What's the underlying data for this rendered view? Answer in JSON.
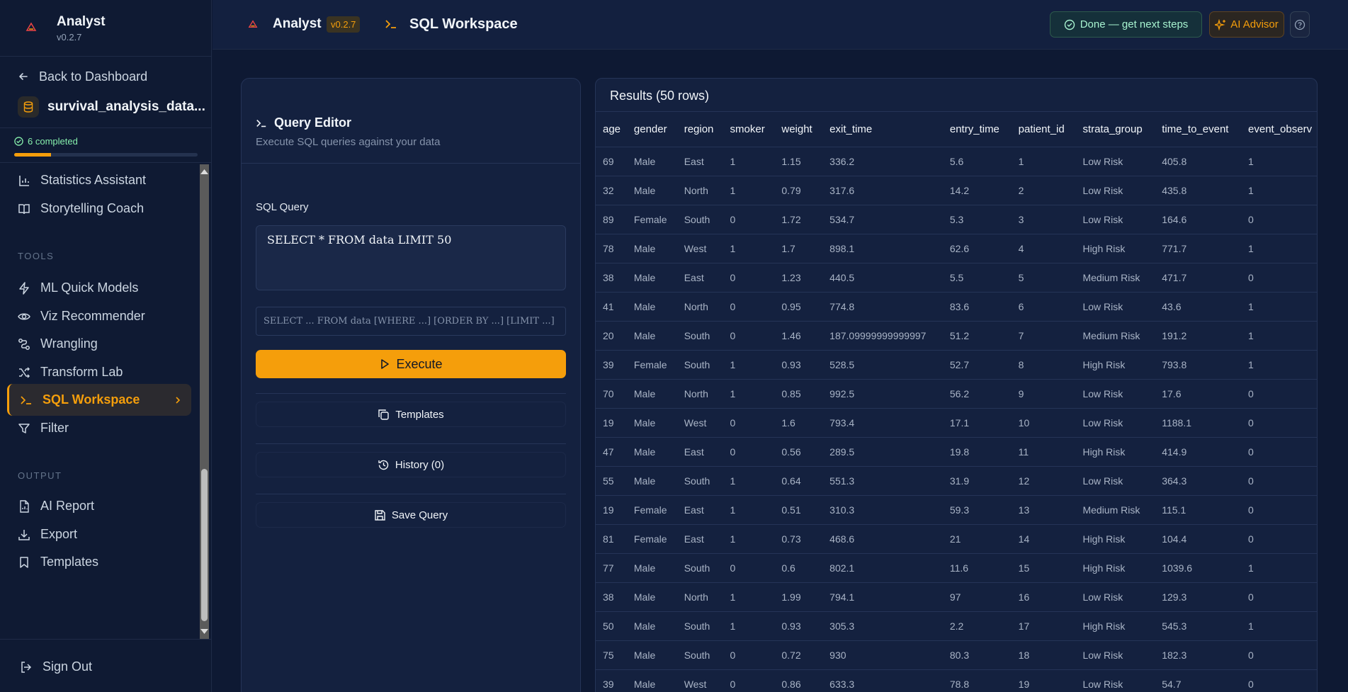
{
  "app": {
    "name": "Analyst",
    "version": "v0.2.7",
    "version_badge": "v0.2.7",
    "page_title": "SQL Workspace"
  },
  "sidebar": {
    "back_label": "Back to Dashboard",
    "dataset_name": "survival_analysis_data...",
    "progress": {
      "label": "6 completed",
      "fraction": 0.2
    },
    "items": [
      {
        "label": "Statistics Assistant",
        "icon": "bar-chart-icon"
      },
      {
        "label": "Storytelling Coach",
        "icon": "book-icon"
      }
    ],
    "tools_heading": "TOOLS",
    "tools": [
      {
        "label": "ML Quick Models",
        "icon": "lightning-icon"
      },
      {
        "label": "Viz Recommender",
        "icon": "eye-icon"
      },
      {
        "label": "Wrangling",
        "icon": "route-icon"
      },
      {
        "label": "Transform Lab",
        "icon": "shuffle-icon"
      },
      {
        "label": "SQL Workspace",
        "icon": "terminal-icon",
        "active": true
      },
      {
        "label": "Filter",
        "icon": "filter-icon"
      }
    ],
    "output_heading": "OUTPUT",
    "output": [
      {
        "label": "AI Report",
        "icon": "report-icon"
      },
      {
        "label": "Export",
        "icon": "download-icon"
      },
      {
        "label": "Templates",
        "icon": "bookmark-icon"
      }
    ],
    "signout_label": "Sign Out"
  },
  "topbar": {
    "done_label": "Done — get next steps",
    "advisor_label": "AI Advisor",
    "accent": "#f59e0b"
  },
  "editor": {
    "title": "Query Editor",
    "subtitle": "Execute SQL queries against your data",
    "query_label": "SQL Query",
    "query_value": "SELECT * FROM data LIMIT 50",
    "syntax_hint": "SELECT ... FROM data [WHERE ...] [ORDER BY ...] [LIMIT ...]",
    "execute_label": "Execute",
    "templates_label": "Templates",
    "history_label": "History (0)",
    "save_label": "Save Query"
  },
  "results": {
    "title": "Results (50 rows)",
    "columns": [
      "age",
      "gender",
      "region",
      "smoker",
      "weight",
      "exit_time",
      "entry_time",
      "patient_id",
      "strata_group",
      "time_to_event",
      "event_observ"
    ],
    "rows": [
      [
        "69",
        "Male",
        "East",
        "1",
        "1.15",
        "336.2",
        "5.6",
        "1",
        "Low Risk",
        "405.8",
        "1"
      ],
      [
        "32",
        "Male",
        "North",
        "1",
        "0.79",
        "317.6",
        "14.2",
        "2",
        "Low Risk",
        "435.8",
        "1"
      ],
      [
        "89",
        "Female",
        "South",
        "0",
        "1.72",
        "534.7",
        "5.3",
        "3",
        "Low Risk",
        "164.6",
        "0"
      ],
      [
        "78",
        "Male",
        "West",
        "1",
        "1.7",
        "898.1",
        "62.6",
        "4",
        "High Risk",
        "771.7",
        "1"
      ],
      [
        "38",
        "Male",
        "East",
        "0",
        "1.23",
        "440.5",
        "5.5",
        "5",
        "Medium Risk",
        "471.7",
        "0"
      ],
      [
        "41",
        "Male",
        "North",
        "0",
        "0.95",
        "774.8",
        "83.6",
        "6",
        "Low Risk",
        "43.6",
        "1"
      ],
      [
        "20",
        "Male",
        "South",
        "0",
        "1.46",
        "187.09999999999997",
        "51.2",
        "7",
        "Medium Risk",
        "191.2",
        "1"
      ],
      [
        "39",
        "Female",
        "South",
        "1",
        "0.93",
        "528.5",
        "52.7",
        "8",
        "High Risk",
        "793.8",
        "1"
      ],
      [
        "70",
        "Male",
        "North",
        "1",
        "0.85",
        "992.5",
        "56.2",
        "9",
        "Low Risk",
        "17.6",
        "0"
      ],
      [
        "19",
        "Male",
        "West",
        "0",
        "1.6",
        "793.4",
        "17.1",
        "10",
        "Low Risk",
        "1188.1",
        "0"
      ],
      [
        "47",
        "Male",
        "East",
        "0",
        "0.56",
        "289.5",
        "19.8",
        "11",
        "High Risk",
        "414.9",
        "0"
      ],
      [
        "55",
        "Male",
        "South",
        "1",
        "0.64",
        "551.3",
        "31.9",
        "12",
        "Low Risk",
        "364.3",
        "0"
      ],
      [
        "19",
        "Female",
        "East",
        "1",
        "0.51",
        "310.3",
        "59.3",
        "13",
        "Medium Risk",
        "115.1",
        "0"
      ],
      [
        "81",
        "Female",
        "East",
        "1",
        "0.73",
        "468.6",
        "21",
        "14",
        "High Risk",
        "104.4",
        "0"
      ],
      [
        "77",
        "Male",
        "South",
        "0",
        "0.6",
        "802.1",
        "11.6",
        "15",
        "High Risk",
        "1039.6",
        "1"
      ],
      [
        "38",
        "Male",
        "North",
        "1",
        "1.99",
        "794.1",
        "97",
        "16",
        "Low Risk",
        "129.3",
        "0"
      ],
      [
        "50",
        "Male",
        "South",
        "1",
        "0.93",
        "305.3",
        "2.2",
        "17",
        "High Risk",
        "545.3",
        "1"
      ],
      [
        "75",
        "Male",
        "South",
        "0",
        "0.72",
        "930",
        "80.3",
        "18",
        "Low Risk",
        "182.3",
        "0"
      ],
      [
        "39",
        "Male",
        "West",
        "0",
        "0.86",
        "633.3",
        "78.8",
        "19",
        "Low Risk",
        "54.7",
        "0"
      ]
    ]
  }
}
